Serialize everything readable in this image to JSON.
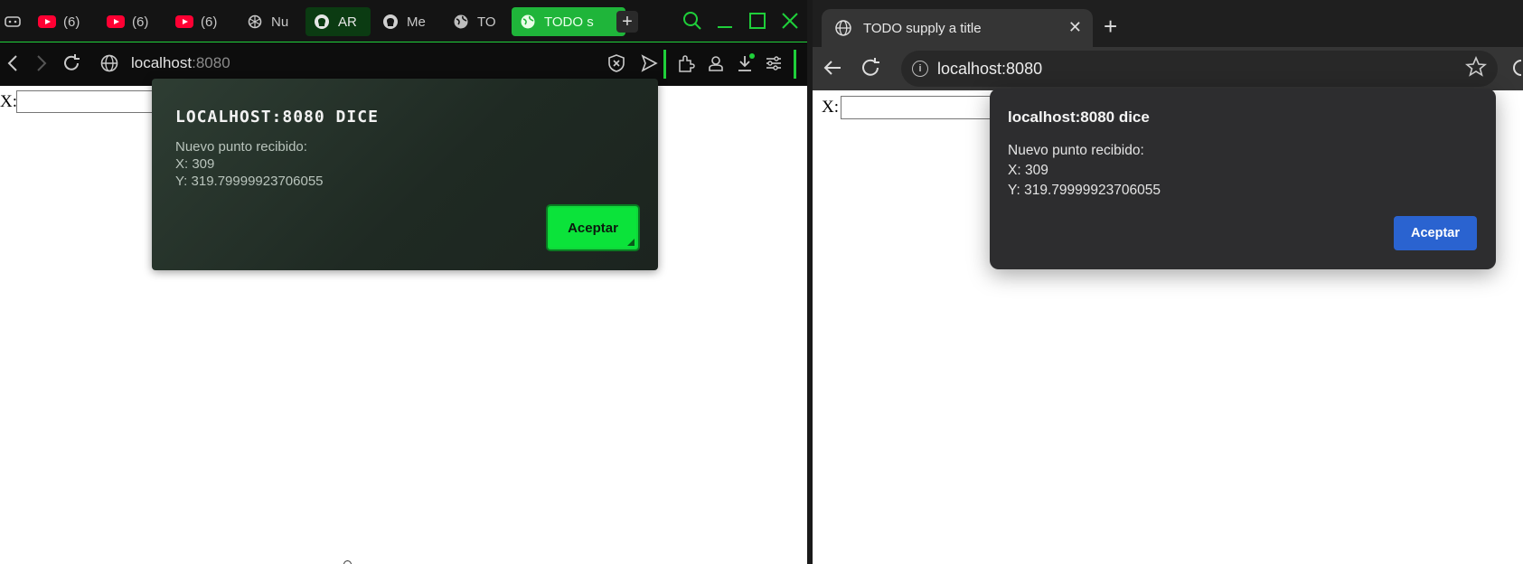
{
  "left_browser": {
    "tabs": [
      {
        "label": "",
        "icon": "gamepad-icon"
      },
      {
        "label": "(6)",
        "icon": "youtube-icon"
      },
      {
        "label": "(6)",
        "icon": "youtube-icon"
      },
      {
        "label": "(6)",
        "icon": "youtube-icon"
      },
      {
        "label": "Nu",
        "icon": "openai-icon"
      },
      {
        "label": "AR",
        "icon": "github-icon"
      },
      {
        "label": "Me",
        "icon": "github-icon"
      },
      {
        "label": "TO",
        "icon": "globe-icon"
      },
      {
        "label": "TODO s",
        "icon": "globe-icon"
      }
    ],
    "new_tab_label": "+",
    "url_host": "localhost",
    "url_port": ":8080",
    "accent_color": "#1fcf3a",
    "page": {
      "x_label": "X:"
    },
    "dialog": {
      "title": "LOCALHOST:8080 DICE",
      "message": "Nuevo punto recibido:\nX: 309\nY: 319.79999923706055",
      "ok_label": "Aceptar"
    }
  },
  "right_browser": {
    "tab_title": "TODO supply a title",
    "close_label": "✕",
    "new_tab_label": "+",
    "url": "localhost:8080",
    "page": {
      "x_label": "X:"
    },
    "dialog": {
      "title": "localhost:8080 dice",
      "message": "Nuevo punto recibido:\nX: 309\nY: 319.79999923706055",
      "ok_label": "Aceptar"
    },
    "button_color": "#2a63d0"
  }
}
